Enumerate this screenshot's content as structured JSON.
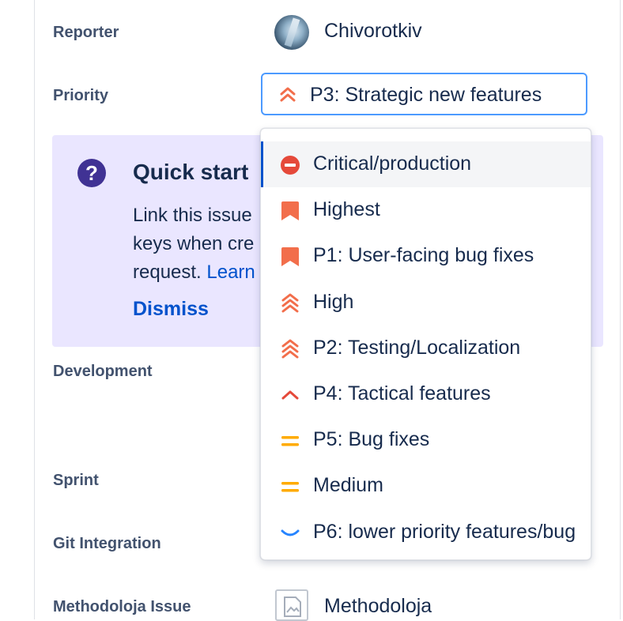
{
  "fields": {
    "reporter": {
      "label": "Reporter",
      "value": "Chivorotkiv"
    },
    "priority": {
      "label": "Priority",
      "value": "P3: Strategic new features",
      "icon": "chevron-double-up-icon"
    },
    "development": {
      "label": "Development"
    },
    "sprint": {
      "label": "Sprint"
    },
    "git_integration": {
      "label": "Git Integration"
    },
    "methodoloja_issue": {
      "label": "Methodoloja Issue",
      "value": "Methodoloja"
    }
  },
  "quick_start": {
    "icon": "?",
    "title": "Quick start",
    "line1": "Link this issue",
    "line2": "keys when cre",
    "line3_prefix": "request. ",
    "link": "Learn",
    "dismiss": "Dismiss"
  },
  "priority_options": [
    {
      "label": "Critical/production",
      "icon": "blocker-icon",
      "color": "#e5493a"
    },
    {
      "label": "Highest",
      "icon": "flag-icon",
      "color": "#f26e4b"
    },
    {
      "label": "P1: User-facing bug fixes",
      "icon": "flag-icon",
      "color": "#f26e4b"
    },
    {
      "label": "High",
      "icon": "chevron-triple-up-icon",
      "color": "#f26e4b"
    },
    {
      "label": "P2: Testing/Localization",
      "icon": "chevron-triple-up-icon",
      "color": "#f26e4b"
    },
    {
      "label": "P4: Tactical features",
      "icon": "chevron-up-icon",
      "color": "#e5493a"
    },
    {
      "label": "P5: Bug fixes",
      "icon": "equals-icon",
      "color": "#ffab00"
    },
    {
      "label": "Medium",
      "icon": "equals-icon",
      "color": "#ffab00"
    },
    {
      "label": "P6: lower priority features/bug",
      "icon": "chevron-down-icon",
      "color": "#2684ff"
    }
  ],
  "colors": {
    "accent": "#0052cc",
    "focus_border": "#4c9aff",
    "quick_start_bg": "#eae6ff",
    "quick_start_icon": "#403294"
  }
}
